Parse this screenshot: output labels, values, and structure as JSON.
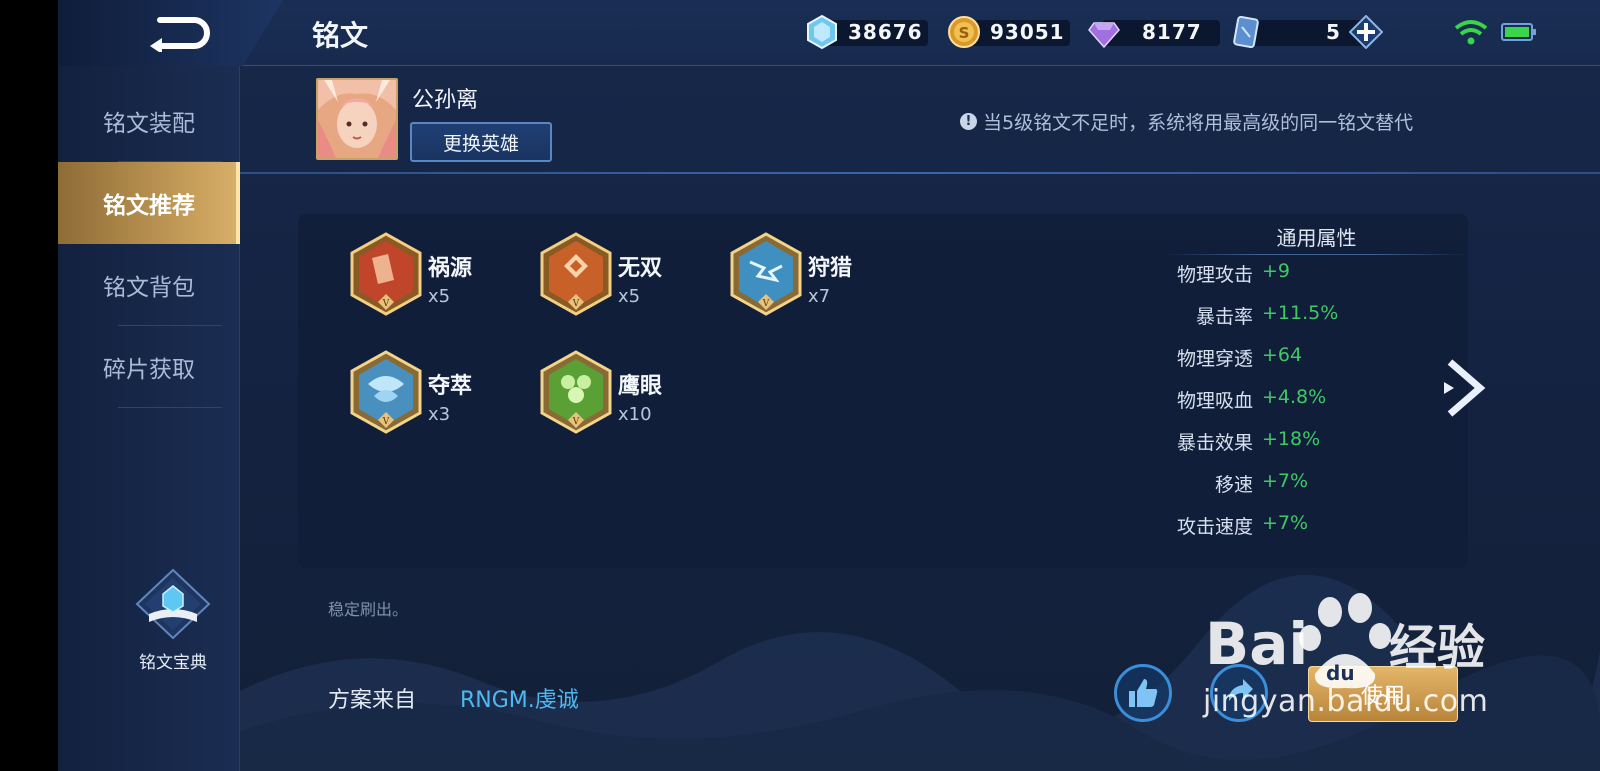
{
  "header": {
    "title": "铭文",
    "currencies": [
      {
        "icon": "diamond-coupon-icon",
        "value": "38676"
      },
      {
        "icon": "gold-coin-icon",
        "value": "93051"
      },
      {
        "icon": "purple-gem-icon",
        "value": "8177"
      },
      {
        "icon": "card-ticket-icon",
        "value": "5"
      }
    ],
    "wifi_icon": "wifi-icon",
    "battery_icon": "battery-icon"
  },
  "sidebar": {
    "items": [
      {
        "label": "铭文装配",
        "active": false
      },
      {
        "label": "铭文推荐",
        "active": true
      },
      {
        "label": "铭文背包",
        "active": false
      },
      {
        "label": "碎片获取",
        "active": false
      }
    ],
    "codex_label": "铭文宝典"
  },
  "hero": {
    "name": "公孙离",
    "change_button": "更换英雄",
    "notice": "当5级铭文不足时，系统将用最高级的同一铭文替代"
  },
  "runes": [
    {
      "name": "祸源",
      "count": "x5",
      "color": "#c0452a"
    },
    {
      "name": "无双",
      "count": "x5",
      "color": "#c8602a"
    },
    {
      "name": "狩猎",
      "count": "x7",
      "color": "#3f8fc0"
    },
    {
      "name": "夺萃",
      "count": "x3",
      "color": "#4a90bf"
    },
    {
      "name": "鹰眼",
      "count": "x10",
      "color": "#5aa035"
    }
  ],
  "attributes": {
    "title": "通用属性",
    "rows": [
      {
        "name": "物理攻击",
        "value": "+9"
      },
      {
        "name": "暴击率",
        "value": "+11.5%"
      },
      {
        "name": "物理穿透",
        "value": "+64"
      },
      {
        "name": "物理吸血",
        "value": "+4.8%"
      },
      {
        "name": "暴击效果",
        "value": "+18%"
      },
      {
        "name": "移速",
        "value": "+7%"
      },
      {
        "name": "攻击速度",
        "value": "+7%"
      }
    ]
  },
  "footnote": "稳定刷出。",
  "source": {
    "label": "方案来自",
    "value": "RNGM.虔诚"
  },
  "actions": {
    "use_label": "使用"
  },
  "watermark": {
    "logo_text": "Bai 经验",
    "url": "jingyan.baidu.com"
  },
  "colors": {
    "accent_gold": "#c49c58",
    "attr_green": "#3fc865",
    "source_blue": "#4fb8f0"
  }
}
